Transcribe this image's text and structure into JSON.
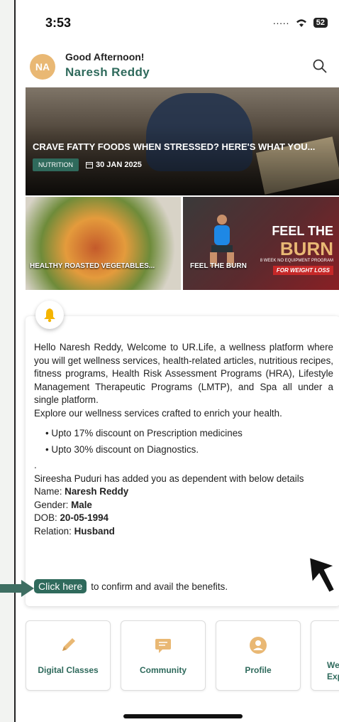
{
  "status_bar": {
    "time": "3:53",
    "battery": "52"
  },
  "header": {
    "avatar_initials": "NA",
    "greeting": "Good Afternoon!",
    "user_name": "Naresh Reddy"
  },
  "hero": {
    "title": "CRAVE FATTY FOODS WHEN STRESSED? HERE'S WHAT YOU...",
    "tag": "NUTRITION",
    "date": "30 JAN 2025"
  },
  "tiles": [
    {
      "label": "HEALTHY ROASTED VEGETABLES..."
    },
    {
      "label": "FEEL THE BURN",
      "overlay_top": "FEEL THE",
      "overlay_main": "BURN",
      "overlay_sub": "8 WEEK NO EQUIPMENT PROGRAM",
      "overlay_badge": "FOR WEIGHT LOSS"
    }
  ],
  "notification": {
    "intro": "Hello Naresh Reddy, Welcome to UR.Life, a wellness platform where you will get wellness services, health-related articles, nutritious recipes, fitness programs, Health Risk Assessment Programs (HRA), Lifestyle Management Therapeutic Programs (LMTP), and Spa all under a single platform.",
    "explore": "Explore our wellness services crafted to enrich your health.",
    "bullets": [
      "Upto 17% discount on Prescription medicines",
      "Upto 30% discount on Diagnostics."
    ],
    "dot": ".",
    "dependent_text": "Sireesha Puduri has added you as dependent with below details",
    "details": [
      {
        "label": "Name: ",
        "value": "Naresh Reddy"
      },
      {
        "label": "Gender: ",
        "value": "Male"
      },
      {
        "label": "DOB: ",
        "value": "20-05-1994"
      },
      {
        "label": "Relation: ",
        "value": "Husband"
      }
    ],
    "cta_button": "Click here",
    "cta_text": "to confirm and avail the benefits."
  },
  "quick_links": [
    {
      "label": "Digital Classes",
      "icon": "pencil-icon"
    },
    {
      "label": "Community",
      "icon": "chat-icon"
    },
    {
      "label": "Profile",
      "icon": "user-icon"
    },
    {
      "label": "We",
      "label2": "Exp",
      "icon": "none"
    }
  ],
  "colors": {
    "accent": "#2f6a5c",
    "gold": "#e9b874"
  }
}
